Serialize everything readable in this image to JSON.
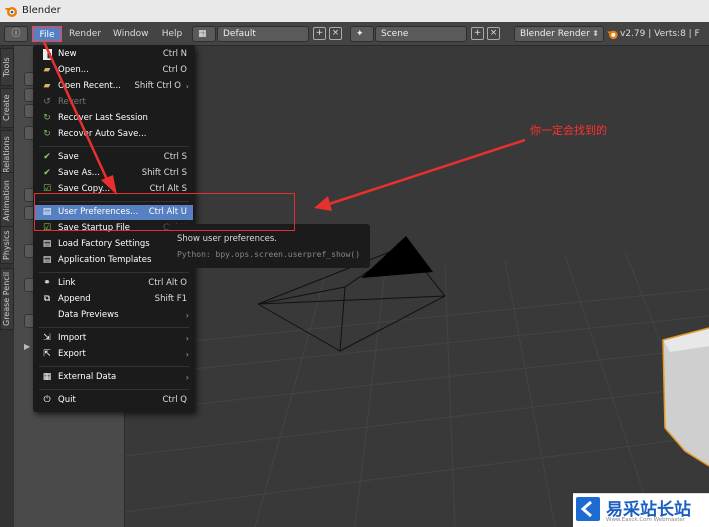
{
  "window": {
    "title": "Blender"
  },
  "header": {
    "menus": [
      "File",
      "Render",
      "Window",
      "Help"
    ],
    "layout_value": "Default",
    "scene_value": "Scene",
    "engine_value": "Blender Render",
    "stats": "v2.79 | Verts:8 | F"
  },
  "left_tabs": [
    "Tools",
    "Create",
    "Relations",
    "Animation",
    "Physics",
    "Grease Pencil"
  ],
  "file_menu": {
    "items": [
      {
        "icon": "new-file-icon",
        "label": "New",
        "shortcut": "Ctrl N"
      },
      {
        "icon": "open-folder-icon",
        "label": "Open...",
        "shortcut": "Ctrl O"
      },
      {
        "icon": "open-recent-icon",
        "label": "Open Recent...",
        "shortcut": "Shift Ctrl O"
      },
      {
        "icon": "revert-icon",
        "label": "Revert",
        "shortcut": ""
      },
      {
        "icon": "recover-icon",
        "label": "Recover Last Session",
        "shortcut": ""
      },
      {
        "icon": "recover-auto-icon",
        "label": "Recover Auto Save...",
        "shortcut": ""
      },
      {
        "icon": "save-check-icon",
        "label": "Save",
        "shortcut": "Ctrl S"
      },
      {
        "icon": "save-as-icon",
        "label": "Save As...",
        "shortcut": "Shift Ctrl S"
      },
      {
        "icon": "save-copy-icon",
        "label": "Save Copy...",
        "shortcut": "Ctrl Alt S"
      },
      {
        "icon": "preferences-icon",
        "label": "User Preferences...",
        "shortcut": "Ctrl Alt U"
      },
      {
        "icon": "save-startup-icon",
        "label": "Save Startup File",
        "shortcut": "Ctrl U"
      },
      {
        "icon": "load-factory-icon",
        "label": "Load Factory Settings",
        "shortcut": ""
      },
      {
        "icon": "templates-icon",
        "label": "Application Templates",
        "shortcut": ""
      },
      {
        "icon": "link-icon",
        "label": "Link",
        "shortcut": "Ctrl Alt O"
      },
      {
        "icon": "append-icon",
        "label": "Append",
        "shortcut": "Shift F1"
      },
      {
        "icon": "",
        "label": "Data Previews",
        "shortcut": ""
      },
      {
        "icon": "import-icon",
        "label": "Import",
        "shortcut": ""
      },
      {
        "icon": "export-icon",
        "label": "Export",
        "shortcut": ""
      },
      {
        "icon": "external-data-icon",
        "label": "External Data",
        "shortcut": ""
      },
      {
        "icon": "quit-icon",
        "label": "Quit",
        "shortcut": "Ctrl Q"
      }
    ]
  },
  "tooltip": {
    "title": "Show user preferences.",
    "python": "Python: bpy.ops.screen.userpref_show()"
  },
  "annotation": {
    "text": "你一定会找到的"
  },
  "watermark": {
    "text": "易采站长站",
    "url": "Www.Easck.Com Webmaster"
  },
  "colors": {
    "highlight": "#5680c2",
    "annotation": "#e03030",
    "menu_bg": "#1b1b1b"
  }
}
